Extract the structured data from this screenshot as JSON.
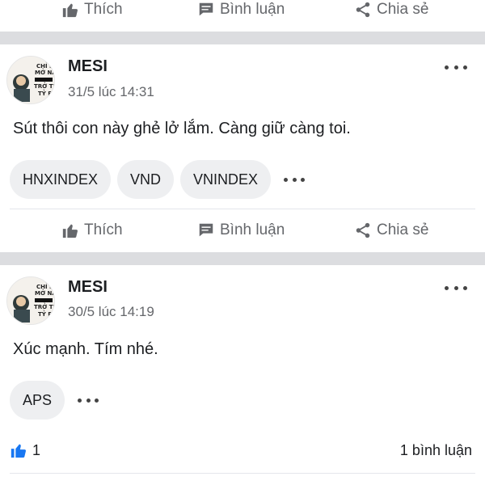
{
  "top_actions": {
    "like_label": "Thích",
    "comment_label": "Bình luận",
    "share_label": "Chia sẻ"
  },
  "posts": [
    {
      "author": "MESI",
      "time": "31/5 lúc 14:31",
      "text": "Sút thôi con này ghẻ lở lắm. Càng giữ càng toi.",
      "tags": [
        "HNXINDEX",
        "VND",
        "VNINDEX"
      ],
      "actions": {
        "like_label": "Thích",
        "comment_label": "Bình luận",
        "share_label": "Chia sẻ"
      }
    },
    {
      "author": "MESI",
      "time": "30/5 lúc 14:19",
      "text": "Xúc mạnh. Tím nhé.",
      "tags": [
        "APS"
      ],
      "likes_count": "1",
      "comments_count": "1 bình luận"
    }
  ],
  "colors": {
    "muted": "#65676b",
    "separator": "#dcdde0",
    "tag_bg": "#eeeff1",
    "like_blue": "#1877f2"
  },
  "icons": {
    "like": "thumbs-up-icon",
    "comment": "comment-bubble-icon",
    "share": "share-icon",
    "more": "more-dots-icon"
  }
}
